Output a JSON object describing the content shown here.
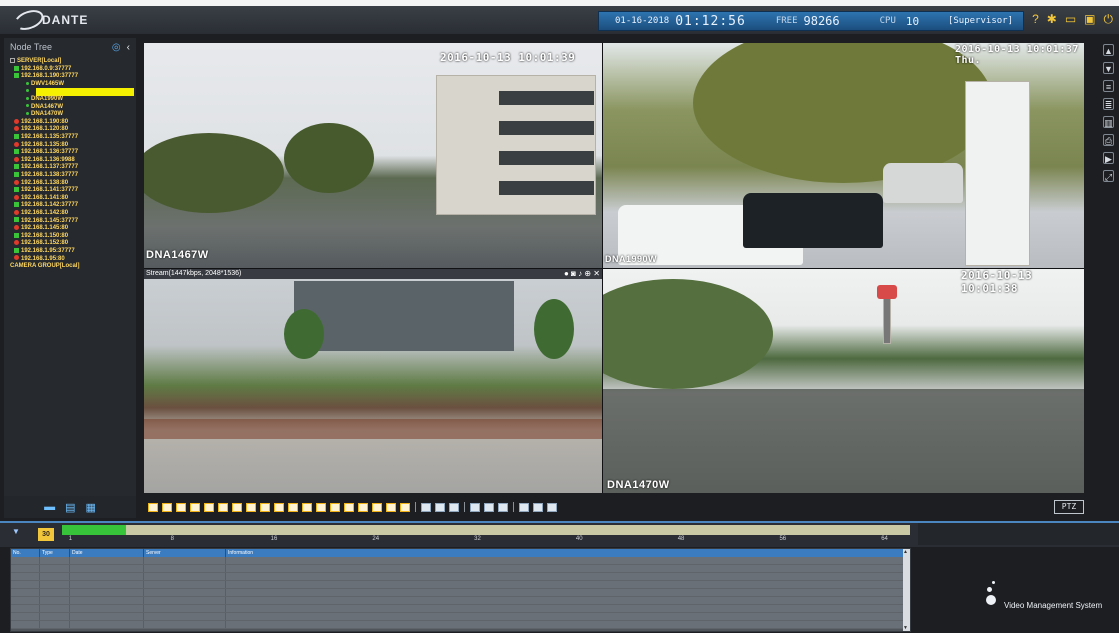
{
  "app": {
    "logo_text": "DANTE",
    "brand_text": "Video Management System"
  },
  "status": {
    "date": "01-16-2018",
    "time": "01:12:56",
    "free_label": "FREE",
    "free_value": "98266",
    "cpu_label": "CPU",
    "cpu_value": "10",
    "user": "[Supervisor]"
  },
  "top_icons": [
    "help-icon",
    "settings-icon",
    "window-icon",
    "lock-icon",
    "power-icon"
  ],
  "sidebar": {
    "title": "Node Tree",
    "items": [
      {
        "label": "SERVER[Local]",
        "marker": "minus"
      },
      {
        "label": "192.168.0.9:37777",
        "marker": "green"
      },
      {
        "label": "192.168.1.190:37777",
        "marker": "green"
      },
      {
        "label": "DWV1465W",
        "marker": "dot"
      },
      {
        "label": "",
        "marker": "dot",
        "selected": true
      },
      {
        "label": "DNA1990W",
        "marker": "dot"
      },
      {
        "label": "DNA1467W",
        "marker": "dot"
      },
      {
        "label": "DNA1470W",
        "marker": "dot"
      },
      {
        "label": "192.168.1.190:80",
        "marker": "red"
      },
      {
        "label": "192.168.1.120:80",
        "marker": "red"
      },
      {
        "label": "192.168.1.135:37777",
        "marker": "green"
      },
      {
        "label": "192.168.1.135:80",
        "marker": "red"
      },
      {
        "label": "192.168.1.136:37777",
        "marker": "green"
      },
      {
        "label": "192.168.1.136:9988",
        "marker": "red"
      },
      {
        "label": "192.168.1.137:37777",
        "marker": "green"
      },
      {
        "label": "192.168.1.138:37777",
        "marker": "green"
      },
      {
        "label": "192.168.1.138:80",
        "marker": "red"
      },
      {
        "label": "192.168.1.141:37777",
        "marker": "green"
      },
      {
        "label": "192.168.1.141:80",
        "marker": "red"
      },
      {
        "label": "192.168.1.142:37777",
        "marker": "green"
      },
      {
        "label": "192.168.1.142:80",
        "marker": "red"
      },
      {
        "label": "192.168.1.145:37777",
        "marker": "green"
      },
      {
        "label": "192.168.1.145:80",
        "marker": "red"
      },
      {
        "label": "192.168.1.150:80",
        "marker": "green"
      },
      {
        "label": "192.168.1.152:80",
        "marker": "red"
      },
      {
        "label": "192.168.1.95:37777",
        "marker": "green"
      },
      {
        "label": "192.168.1.95:80",
        "marker": "red"
      },
      {
        "label": "CAMERA GROUP[Local]",
        "marker": "none"
      }
    ]
  },
  "tiles": [
    {
      "timestamp": "2016-10-13 10:01:39",
      "camera": "DNA1467W"
    },
    {
      "timestamp": "2016-10-13 10:01:37 Thu.",
      "camera": "DNA1990W"
    },
    {
      "timestamp": "",
      "camera": "",
      "stream_info": "Stream(1447kbps, 2048*1536)"
    },
    {
      "timestamp": "2016-10-13 10:01:38",
      "camera": "DNA1470W"
    }
  ],
  "toolbar": {
    "ptz_label": "PTZ"
  },
  "timeline": {
    "progress": 0.075,
    "ticks": [
      "1",
      "8",
      "16",
      "24",
      "32",
      "40",
      "48",
      "56",
      "64"
    ]
  },
  "log_table": {
    "columns": [
      "No.",
      "Type",
      "Date",
      "Server",
      "Information"
    ],
    "rows": 9
  }
}
